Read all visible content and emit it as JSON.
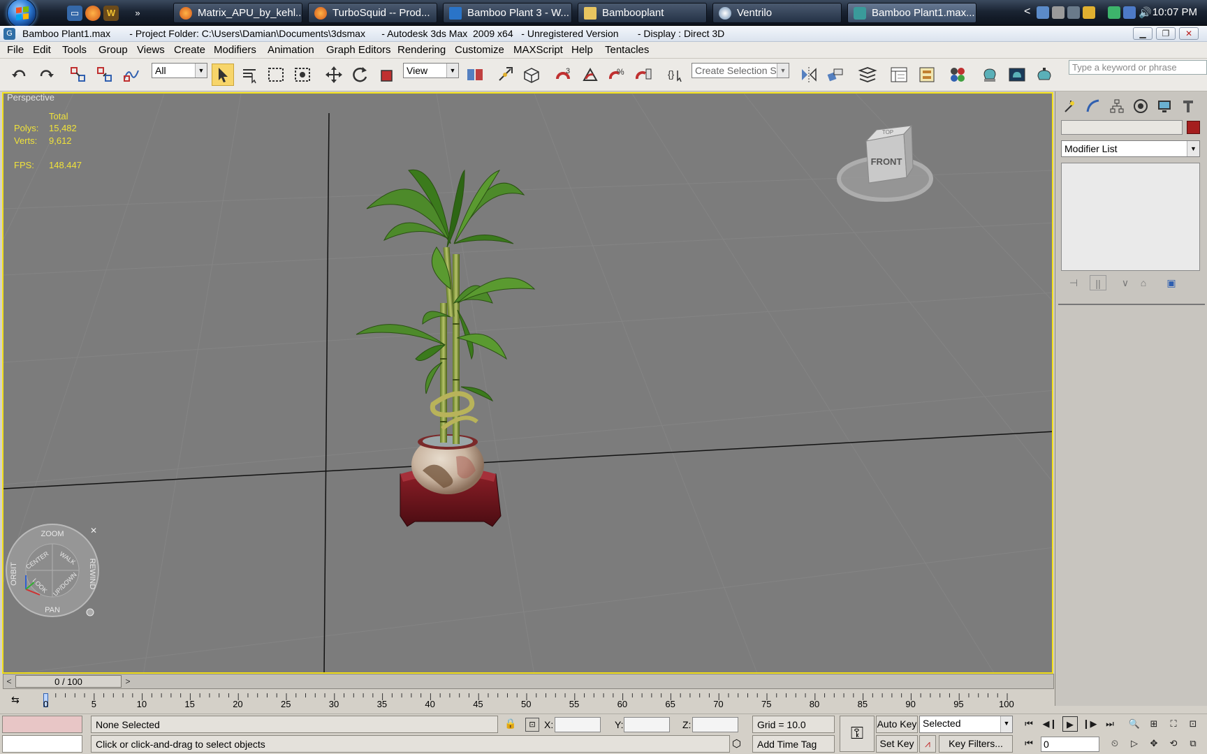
{
  "taskbar": {
    "buttons": [
      {
        "label": "Matrix_APU_by_kehl...",
        "icon": "firefox-icon"
      },
      {
        "label": "TurboSquid -- Prod...",
        "icon": "firefox-icon"
      },
      {
        "label": "Bamboo Plant 3 - W...",
        "icon": "windows-app-icon"
      },
      {
        "label": "Bambooplant",
        "icon": "folder-icon"
      },
      {
        "label": "Ventrilo",
        "icon": "ventrilo-icon"
      },
      {
        "label": "Bamboo Plant1.max...",
        "icon": "3dsmax-icon"
      }
    ],
    "overflow": "»",
    "tray_chevron": "<",
    "clock": "10:07 PM",
    "colors": {
      "accent": "#2c7ad6",
      "bar": "#1a2433"
    }
  },
  "window": {
    "title": "Bamboo Plant1.max       - Project Folder: C:\\Users\\Damian\\Documents\\3dsmax      - Autodesk 3ds Max  2009 x64   - Unregistered Version       - Display : Direct 3D",
    "controls": [
      "minimize",
      "restore",
      "close"
    ]
  },
  "menu": [
    "File",
    "Edit",
    "Tools",
    "Group",
    "Views",
    "Create",
    "Modifiers",
    "Animation",
    "Graph Editors",
    "Rendering",
    "Customize",
    "MAXScript",
    "Help",
    "Tentacles"
  ],
  "toolbar": {
    "selection_filter": "All",
    "reference_coord": "View",
    "selection_set": "Create Selection Set",
    "search_placeholder": "Type a keyword or phrase"
  },
  "viewport": {
    "label": "Perspective",
    "stats": {
      "header": "Total",
      "polys_label": "Polys:",
      "polys": "15,482",
      "verts_label": "Verts:",
      "verts": "9,612",
      "fps_label": "FPS:",
      "fps": "148.447"
    },
    "viewcube": {
      "face": "FRONT",
      "top": "TOP"
    },
    "steering_wheel": [
      "ZOOM",
      "ORBIT",
      "REWIND",
      "PAN",
      "CENTER",
      "WALK",
      "LOOK",
      "UP/DOWN"
    ],
    "border_color": "#f2e01a",
    "background": "#7c7c7c"
  },
  "command_panel": {
    "modifier_list": "Modifier List",
    "object_color": "#a51e1e"
  },
  "timeline": {
    "slider": "0 / 100",
    "ticks": [
      "0",
      "5",
      "10",
      "15",
      "20",
      "25",
      "30",
      "35",
      "40",
      "45",
      "50",
      "55",
      "60",
      "65",
      "70",
      "75",
      "80",
      "85",
      "90",
      "95",
      "100"
    ],
    "prev": "<",
    "next": ">"
  },
  "status": {
    "selection": "None Selected",
    "prompt": "Click or click-and-drag to select objects",
    "x_label": "X:",
    "y_label": "Y:",
    "z_label": "Z:",
    "grid": "Grid = 10.0",
    "add_time_tag": "Add Time Tag",
    "auto_key": "Auto Key",
    "set_key": "Set Key",
    "key_mode": "Selected",
    "key_filters": "Key Filters...",
    "frame": "0"
  }
}
